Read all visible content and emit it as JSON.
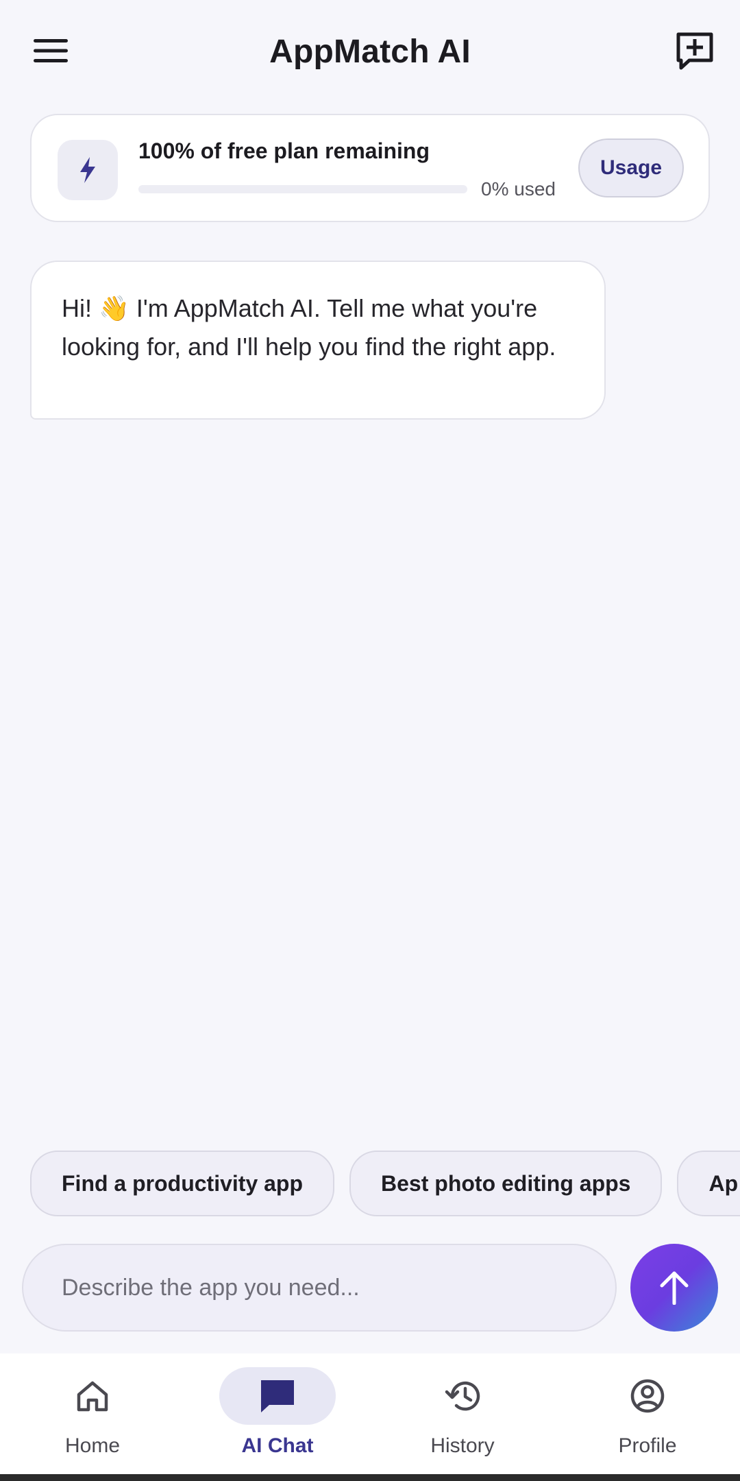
{
  "header": {
    "title": "AppMatch AI",
    "menu_icon": "hamburger-menu-icon",
    "new_chat_icon": "add-chat-icon"
  },
  "usage": {
    "title": "100% of free plan remaining",
    "used_label": "0% used",
    "used_fraction": 0,
    "button_label": "Usage",
    "icon": "bolt-icon"
  },
  "chat": {
    "messages": [
      {
        "role": "assistant",
        "text": "Hi! 👋 I'm AppMatch AI. Tell me what you're looking for, and I'll help you find the right app."
      }
    ]
  },
  "suggestions": [
    "Find a productivity app",
    "Best photo editing apps",
    "Ap"
  ],
  "input": {
    "placeholder": "Describe the app you need...",
    "value": ""
  },
  "nav": {
    "items": [
      {
        "label": "Home",
        "icon": "home-icon",
        "active": false
      },
      {
        "label": "AI Chat",
        "icon": "chat-icon",
        "active": true
      },
      {
        "label": "History",
        "icon": "history-icon",
        "active": false
      },
      {
        "label": "Profile",
        "icon": "profile-icon",
        "active": false
      }
    ]
  },
  "colors": {
    "accent": "#3a3690",
    "background": "#f6f6fb",
    "send_gradient_start": "#7b3fe6",
    "send_gradient_end": "#3a8ad8"
  }
}
